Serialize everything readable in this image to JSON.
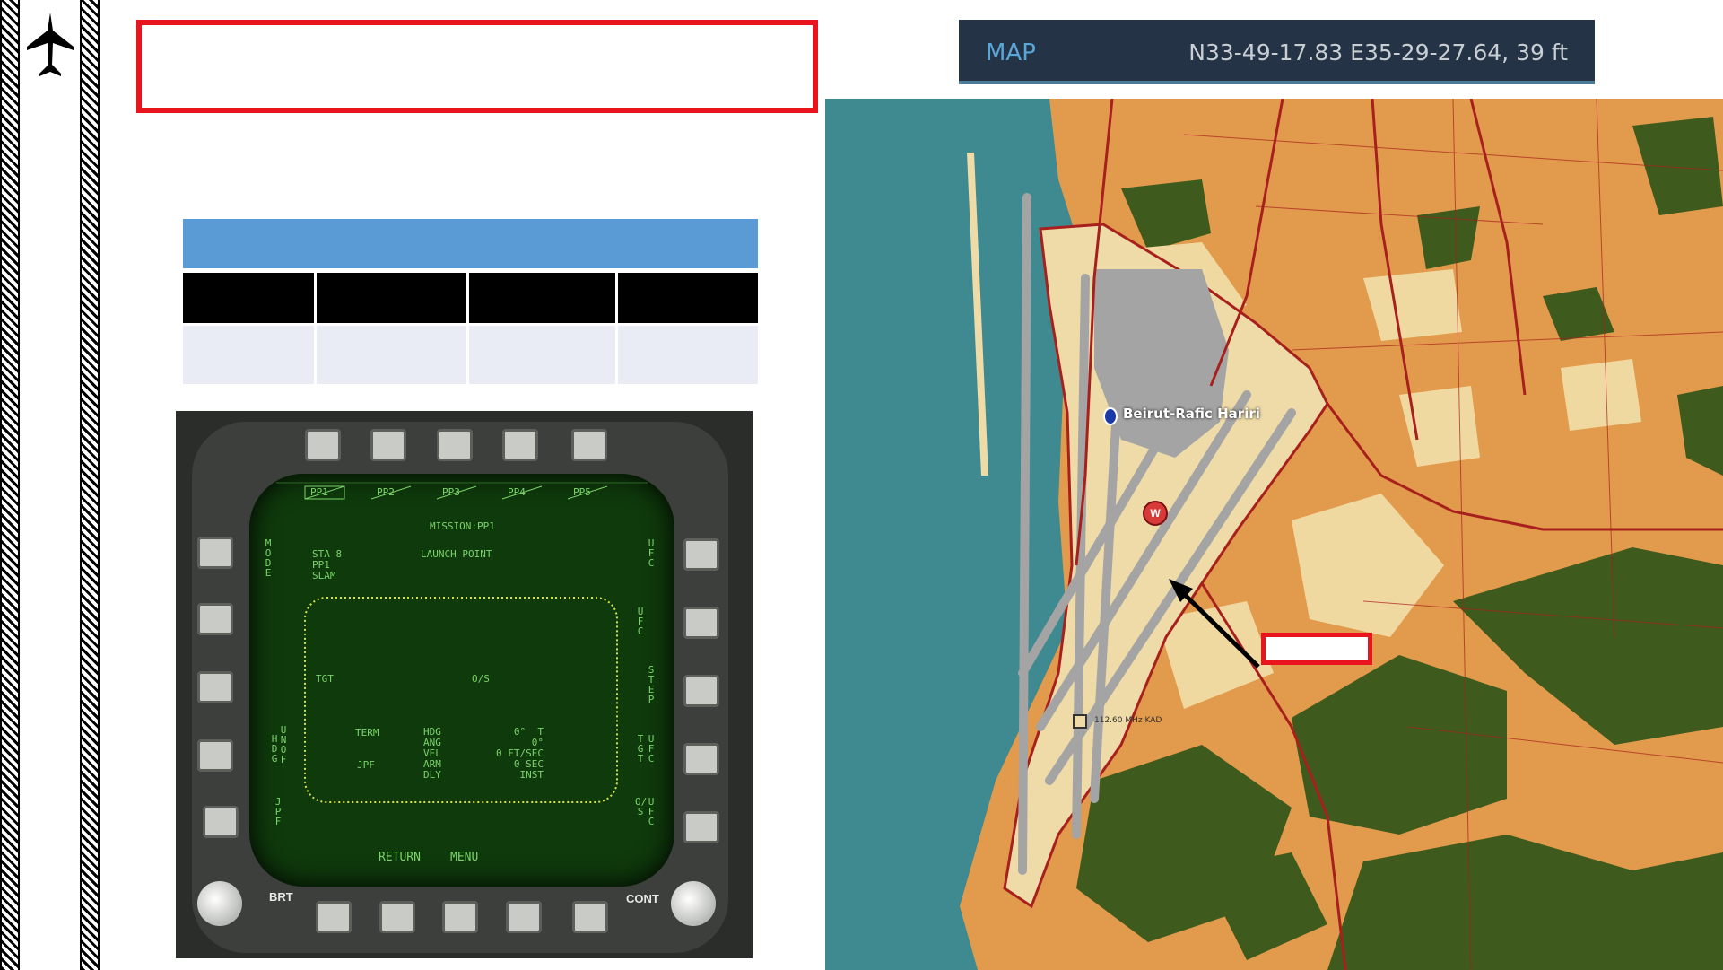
{
  "sidebar": {
    "logo_icon": "fighter-jet-icon"
  },
  "mfd": {
    "pp_labels": [
      "PP1",
      "PP2",
      "PP3",
      "PP4",
      "PP5"
    ],
    "mission": "MISSION:PP1",
    "launch_point": "LAUNCH POINT",
    "station": "STA 8",
    "station_pp": "PP1",
    "weapon": "SLAM",
    "left_mode": "MODE",
    "left_hdg": "HDG",
    "left_unof": "UNOF",
    "left_jpf": "JPF",
    "right_ufc": "UFC",
    "right_step": "STEP",
    "right_tgt": "TGT",
    "right_ufc2": "UFC",
    "right_os": "O/S",
    "right_ufc3": "UFC",
    "tgt": "TGT",
    "os": "O/S",
    "term": "TERM",
    "jpf": "JPF",
    "params": [
      "HDG",
      "ANG",
      "VEL",
      "ARM",
      "DLY"
    ],
    "values": [
      "0°  T",
      "0°",
      "0 FT/SEC",
      "0 SEC",
      "INST"
    ],
    "return": "RETURN",
    "menu": "MENU",
    "brt": "BRT",
    "cont": "CONT"
  },
  "map": {
    "title": "MAP",
    "coords": "N33-49-17.83 E35-29-27.64, 39 ft",
    "airport_name": "Beirut-Rafic Hariri",
    "navaid": "112.60 MHz KAD",
    "waypoint_marker": "W",
    "colors": {
      "sea": "#3e8a90",
      "land": "#e29a4c",
      "urban": "#f0d9a0",
      "forest": "#3e5a1c",
      "road": "#a8201e",
      "runway": "#a4a4a4"
    }
  }
}
